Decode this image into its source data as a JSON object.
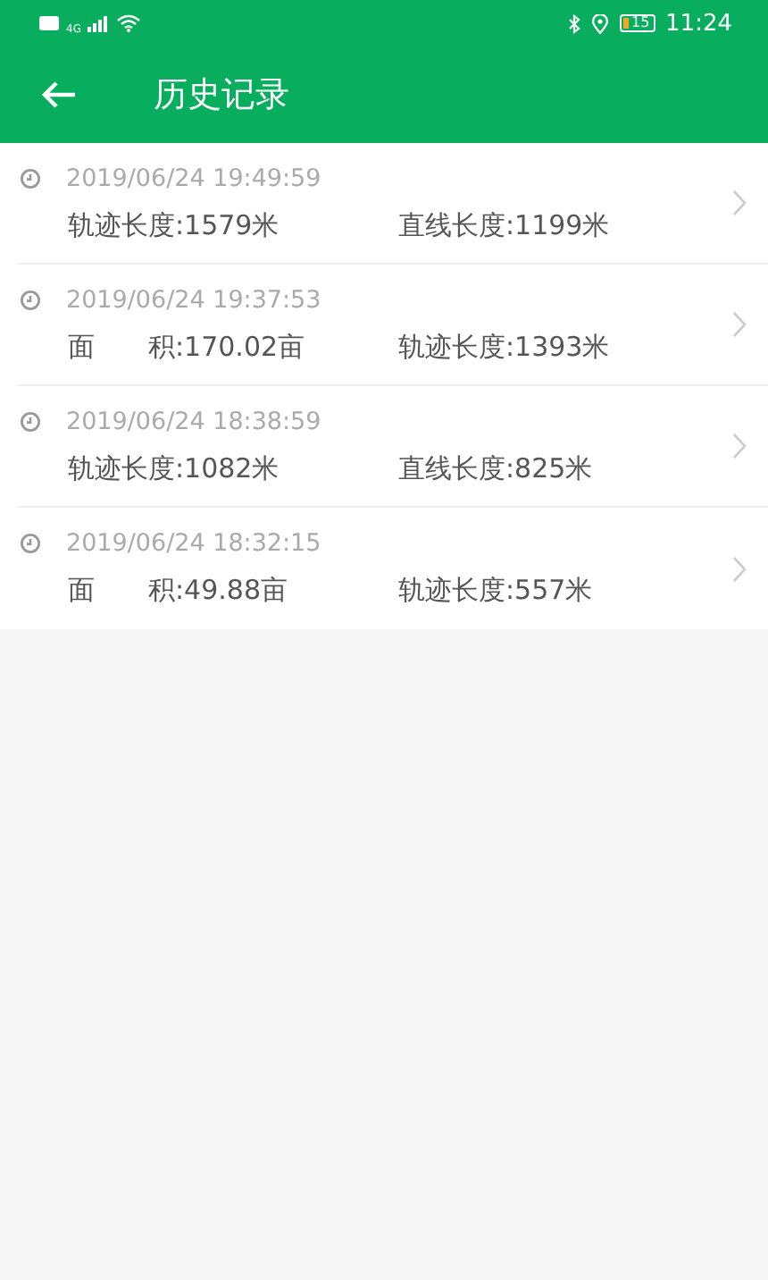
{
  "status_bar": {
    "network": "4G",
    "battery": "15",
    "time": "11:24"
  },
  "header": {
    "title": "历史记录"
  },
  "records": [
    {
      "time": "2019/06/24 19:49:59",
      "stats": [
        "轨迹长度:1579米",
        "直线长度:1199米"
      ]
    },
    {
      "time": "2019/06/24 19:37:53",
      "stats": [
        "面　　积:170.02亩",
        "轨迹长度:1393米"
      ]
    },
    {
      "time": "2019/06/24 18:38:59",
      "stats": [
        "轨迹长度:1082米",
        "直线长度:825米"
      ]
    },
    {
      "time": "2019/06/24 18:32:15",
      "stats": [
        "面　　积:49.88亩",
        "轨迹长度:557米"
      ]
    }
  ]
}
